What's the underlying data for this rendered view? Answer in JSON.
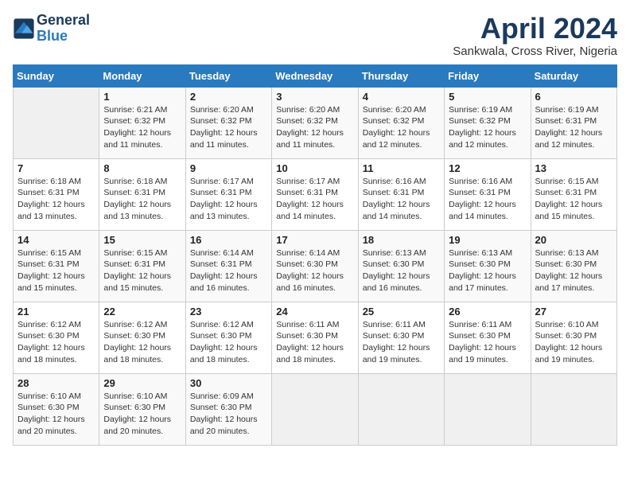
{
  "logo": {
    "line1": "General",
    "line2": "Blue"
  },
  "title": "April 2024",
  "subtitle": "Sankwala, Cross River, Nigeria",
  "header": {
    "days": [
      "Sunday",
      "Monday",
      "Tuesday",
      "Wednesday",
      "Thursday",
      "Friday",
      "Saturday"
    ]
  },
  "weeks": [
    [
      {
        "num": "",
        "info": ""
      },
      {
        "num": "1",
        "info": "Sunrise: 6:21 AM\nSunset: 6:32 PM\nDaylight: 12 hours\nand 11 minutes."
      },
      {
        "num": "2",
        "info": "Sunrise: 6:20 AM\nSunset: 6:32 PM\nDaylight: 12 hours\nand 11 minutes."
      },
      {
        "num": "3",
        "info": "Sunrise: 6:20 AM\nSunset: 6:32 PM\nDaylight: 12 hours\nand 11 minutes."
      },
      {
        "num": "4",
        "info": "Sunrise: 6:20 AM\nSunset: 6:32 PM\nDaylight: 12 hours\nand 12 minutes."
      },
      {
        "num": "5",
        "info": "Sunrise: 6:19 AM\nSunset: 6:32 PM\nDaylight: 12 hours\nand 12 minutes."
      },
      {
        "num": "6",
        "info": "Sunrise: 6:19 AM\nSunset: 6:31 PM\nDaylight: 12 hours\nand 12 minutes."
      }
    ],
    [
      {
        "num": "7",
        "info": "Sunrise: 6:18 AM\nSunset: 6:31 PM\nDaylight: 12 hours\nand 13 minutes."
      },
      {
        "num": "8",
        "info": "Sunrise: 6:18 AM\nSunset: 6:31 PM\nDaylight: 12 hours\nand 13 minutes."
      },
      {
        "num": "9",
        "info": "Sunrise: 6:17 AM\nSunset: 6:31 PM\nDaylight: 12 hours\nand 13 minutes."
      },
      {
        "num": "10",
        "info": "Sunrise: 6:17 AM\nSunset: 6:31 PM\nDaylight: 12 hours\nand 14 minutes."
      },
      {
        "num": "11",
        "info": "Sunrise: 6:16 AM\nSunset: 6:31 PM\nDaylight: 12 hours\nand 14 minutes."
      },
      {
        "num": "12",
        "info": "Sunrise: 6:16 AM\nSunset: 6:31 PM\nDaylight: 12 hours\nand 14 minutes."
      },
      {
        "num": "13",
        "info": "Sunrise: 6:15 AM\nSunset: 6:31 PM\nDaylight: 12 hours\nand 15 minutes."
      }
    ],
    [
      {
        "num": "14",
        "info": "Sunrise: 6:15 AM\nSunset: 6:31 PM\nDaylight: 12 hours\nand 15 minutes."
      },
      {
        "num": "15",
        "info": "Sunrise: 6:15 AM\nSunset: 6:31 PM\nDaylight: 12 hours\nand 15 minutes."
      },
      {
        "num": "16",
        "info": "Sunrise: 6:14 AM\nSunset: 6:31 PM\nDaylight: 12 hours\nand 16 minutes."
      },
      {
        "num": "17",
        "info": "Sunrise: 6:14 AM\nSunset: 6:30 PM\nDaylight: 12 hours\nand 16 minutes."
      },
      {
        "num": "18",
        "info": "Sunrise: 6:13 AM\nSunset: 6:30 PM\nDaylight: 12 hours\nand 16 minutes."
      },
      {
        "num": "19",
        "info": "Sunrise: 6:13 AM\nSunset: 6:30 PM\nDaylight: 12 hours\nand 17 minutes."
      },
      {
        "num": "20",
        "info": "Sunrise: 6:13 AM\nSunset: 6:30 PM\nDaylight: 12 hours\nand 17 minutes."
      }
    ],
    [
      {
        "num": "21",
        "info": "Sunrise: 6:12 AM\nSunset: 6:30 PM\nDaylight: 12 hours\nand 18 minutes."
      },
      {
        "num": "22",
        "info": "Sunrise: 6:12 AM\nSunset: 6:30 PM\nDaylight: 12 hours\nand 18 minutes."
      },
      {
        "num": "23",
        "info": "Sunrise: 6:12 AM\nSunset: 6:30 PM\nDaylight: 12 hours\nand 18 minutes."
      },
      {
        "num": "24",
        "info": "Sunrise: 6:11 AM\nSunset: 6:30 PM\nDaylight: 12 hours\nand 18 minutes."
      },
      {
        "num": "25",
        "info": "Sunrise: 6:11 AM\nSunset: 6:30 PM\nDaylight: 12 hours\nand 19 minutes."
      },
      {
        "num": "26",
        "info": "Sunrise: 6:11 AM\nSunset: 6:30 PM\nDaylight: 12 hours\nand 19 minutes."
      },
      {
        "num": "27",
        "info": "Sunrise: 6:10 AM\nSunset: 6:30 PM\nDaylight: 12 hours\nand 19 minutes."
      }
    ],
    [
      {
        "num": "28",
        "info": "Sunrise: 6:10 AM\nSunset: 6:30 PM\nDaylight: 12 hours\nand 20 minutes."
      },
      {
        "num": "29",
        "info": "Sunrise: 6:10 AM\nSunset: 6:30 PM\nDaylight: 12 hours\nand 20 minutes."
      },
      {
        "num": "30",
        "info": "Sunrise: 6:09 AM\nSunset: 6:30 PM\nDaylight: 12 hours\nand 20 minutes."
      },
      {
        "num": "",
        "info": ""
      },
      {
        "num": "",
        "info": ""
      },
      {
        "num": "",
        "info": ""
      },
      {
        "num": "",
        "info": ""
      }
    ]
  ]
}
